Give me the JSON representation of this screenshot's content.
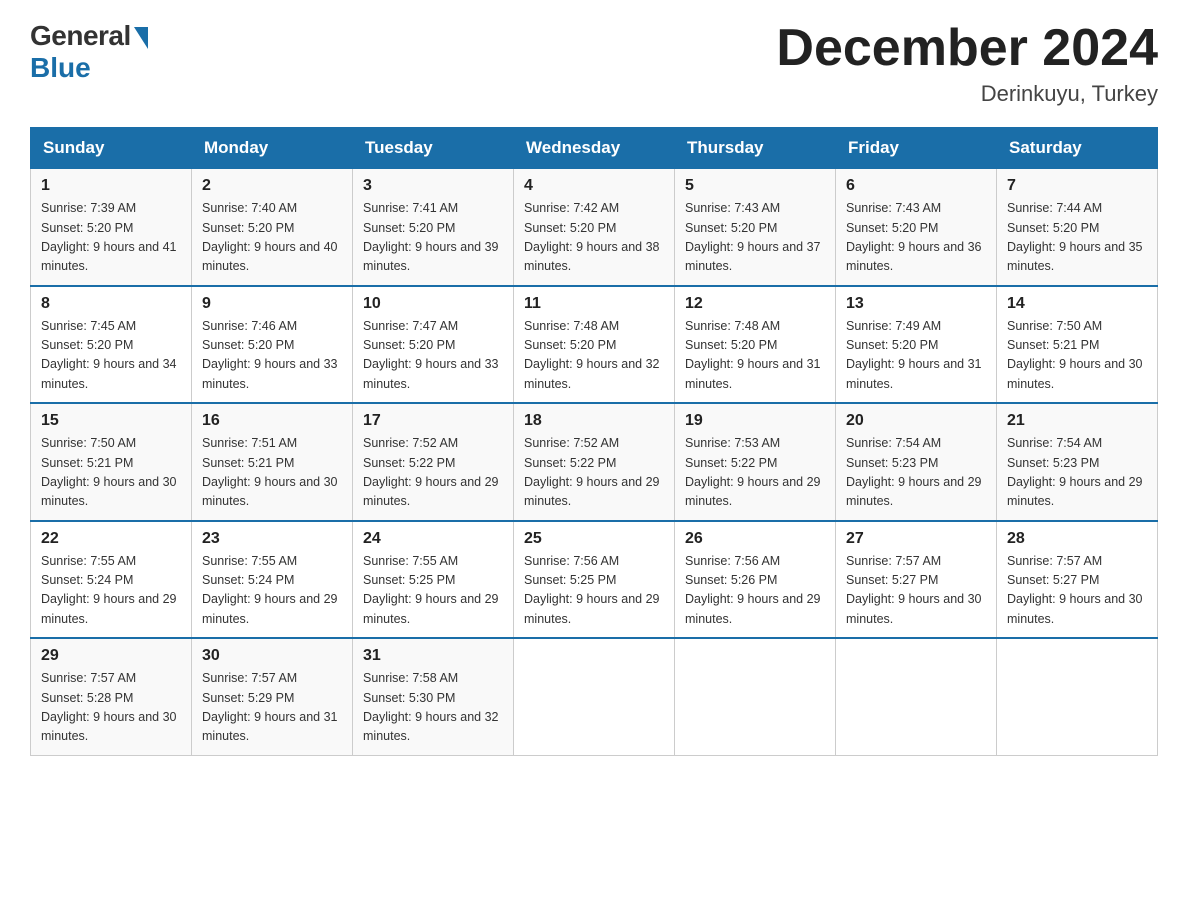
{
  "header": {
    "logo_general": "General",
    "logo_blue": "Blue",
    "month_year": "December 2024",
    "location": "Derinkuyu, Turkey"
  },
  "days_of_week": [
    "Sunday",
    "Monday",
    "Tuesday",
    "Wednesday",
    "Thursday",
    "Friday",
    "Saturday"
  ],
  "weeks": [
    [
      {
        "day": "1",
        "sunrise": "7:39 AM",
        "sunset": "5:20 PM",
        "daylight": "9 hours and 41 minutes."
      },
      {
        "day": "2",
        "sunrise": "7:40 AM",
        "sunset": "5:20 PM",
        "daylight": "9 hours and 40 minutes."
      },
      {
        "day": "3",
        "sunrise": "7:41 AM",
        "sunset": "5:20 PM",
        "daylight": "9 hours and 39 minutes."
      },
      {
        "day": "4",
        "sunrise": "7:42 AM",
        "sunset": "5:20 PM",
        "daylight": "9 hours and 38 minutes."
      },
      {
        "day": "5",
        "sunrise": "7:43 AM",
        "sunset": "5:20 PM",
        "daylight": "9 hours and 37 minutes."
      },
      {
        "day": "6",
        "sunrise": "7:43 AM",
        "sunset": "5:20 PM",
        "daylight": "9 hours and 36 minutes."
      },
      {
        "day": "7",
        "sunrise": "7:44 AM",
        "sunset": "5:20 PM",
        "daylight": "9 hours and 35 minutes."
      }
    ],
    [
      {
        "day": "8",
        "sunrise": "7:45 AM",
        "sunset": "5:20 PM",
        "daylight": "9 hours and 34 minutes."
      },
      {
        "day": "9",
        "sunrise": "7:46 AM",
        "sunset": "5:20 PM",
        "daylight": "9 hours and 33 minutes."
      },
      {
        "day": "10",
        "sunrise": "7:47 AM",
        "sunset": "5:20 PM",
        "daylight": "9 hours and 33 minutes."
      },
      {
        "day": "11",
        "sunrise": "7:48 AM",
        "sunset": "5:20 PM",
        "daylight": "9 hours and 32 minutes."
      },
      {
        "day": "12",
        "sunrise": "7:48 AM",
        "sunset": "5:20 PM",
        "daylight": "9 hours and 31 minutes."
      },
      {
        "day": "13",
        "sunrise": "7:49 AM",
        "sunset": "5:20 PM",
        "daylight": "9 hours and 31 minutes."
      },
      {
        "day": "14",
        "sunrise": "7:50 AM",
        "sunset": "5:21 PM",
        "daylight": "9 hours and 30 minutes."
      }
    ],
    [
      {
        "day": "15",
        "sunrise": "7:50 AM",
        "sunset": "5:21 PM",
        "daylight": "9 hours and 30 minutes."
      },
      {
        "day": "16",
        "sunrise": "7:51 AM",
        "sunset": "5:21 PM",
        "daylight": "9 hours and 30 minutes."
      },
      {
        "day": "17",
        "sunrise": "7:52 AM",
        "sunset": "5:22 PM",
        "daylight": "9 hours and 29 minutes."
      },
      {
        "day": "18",
        "sunrise": "7:52 AM",
        "sunset": "5:22 PM",
        "daylight": "9 hours and 29 minutes."
      },
      {
        "day": "19",
        "sunrise": "7:53 AM",
        "sunset": "5:22 PM",
        "daylight": "9 hours and 29 minutes."
      },
      {
        "day": "20",
        "sunrise": "7:54 AM",
        "sunset": "5:23 PM",
        "daylight": "9 hours and 29 minutes."
      },
      {
        "day": "21",
        "sunrise": "7:54 AM",
        "sunset": "5:23 PM",
        "daylight": "9 hours and 29 minutes."
      }
    ],
    [
      {
        "day": "22",
        "sunrise": "7:55 AM",
        "sunset": "5:24 PM",
        "daylight": "9 hours and 29 minutes."
      },
      {
        "day": "23",
        "sunrise": "7:55 AM",
        "sunset": "5:24 PM",
        "daylight": "9 hours and 29 minutes."
      },
      {
        "day": "24",
        "sunrise": "7:55 AM",
        "sunset": "5:25 PM",
        "daylight": "9 hours and 29 minutes."
      },
      {
        "day": "25",
        "sunrise": "7:56 AM",
        "sunset": "5:25 PM",
        "daylight": "9 hours and 29 minutes."
      },
      {
        "day": "26",
        "sunrise": "7:56 AM",
        "sunset": "5:26 PM",
        "daylight": "9 hours and 29 minutes."
      },
      {
        "day": "27",
        "sunrise": "7:57 AM",
        "sunset": "5:27 PM",
        "daylight": "9 hours and 30 minutes."
      },
      {
        "day": "28",
        "sunrise": "7:57 AM",
        "sunset": "5:27 PM",
        "daylight": "9 hours and 30 minutes."
      }
    ],
    [
      {
        "day": "29",
        "sunrise": "7:57 AM",
        "sunset": "5:28 PM",
        "daylight": "9 hours and 30 minutes."
      },
      {
        "day": "30",
        "sunrise": "7:57 AM",
        "sunset": "5:29 PM",
        "daylight": "9 hours and 31 minutes."
      },
      {
        "day": "31",
        "sunrise": "7:58 AM",
        "sunset": "5:30 PM",
        "daylight": "9 hours and 32 minutes."
      },
      null,
      null,
      null,
      null
    ]
  ]
}
